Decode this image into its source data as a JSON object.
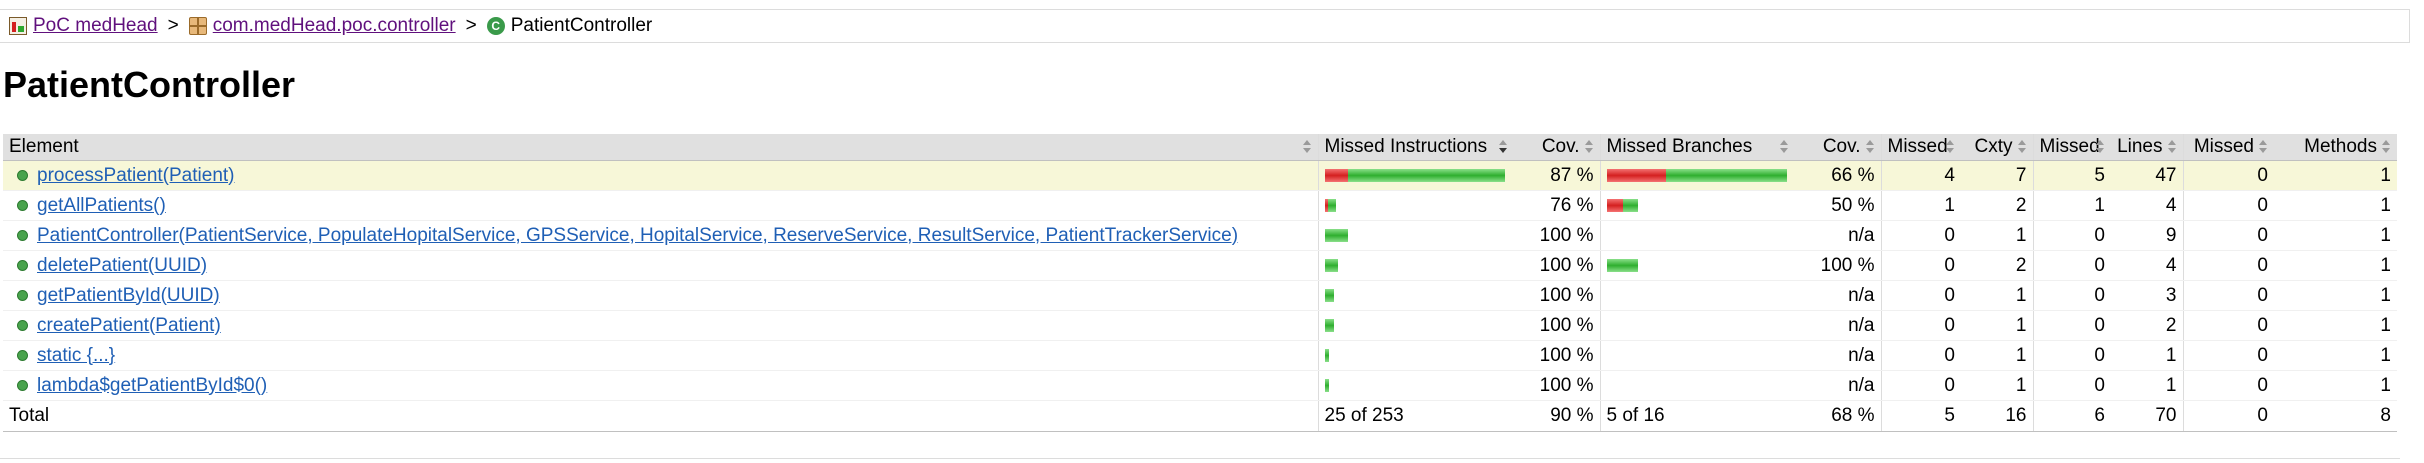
{
  "breadcrumb": {
    "report": "PoC medHead",
    "separator": ">",
    "package": "com.medHead.poc.controller",
    "current": "PatientController"
  },
  "page_title": "PatientController",
  "table": {
    "headers": {
      "element": "Element",
      "missed_instructions": "Missed Instructions",
      "cov1": "Cov.",
      "missed_branches": "Missed Branches",
      "cov2": "Cov.",
      "missed_cxty": "Missed",
      "cxty": "Cxty",
      "missed_lines": "Missed",
      "lines": "Lines",
      "missed_methods": "Missed",
      "methods": "Methods"
    },
    "rows": [
      {
        "name": "processPatient(Patient)",
        "instr_cov": "87 %",
        "branch_cov": "66 %",
        "missed_cxty": "4",
        "cxty": "7",
        "missed_lines": "5",
        "lines": "47",
        "missed_methods": "0",
        "methods": "1"
      },
      {
        "name": "getAllPatients()",
        "instr_cov": "76 %",
        "branch_cov": "50 %",
        "missed_cxty": "1",
        "cxty": "2",
        "missed_lines": "1",
        "lines": "4",
        "missed_methods": "0",
        "methods": "1"
      },
      {
        "name": "PatientController(PatientService, PopulateHopitalService, GPSService, HopitalService, ReserveService, ResultService, PatientTrackerService)",
        "instr_cov": "100 %",
        "branch_cov": "n/a",
        "missed_cxty": "0",
        "cxty": "1",
        "missed_lines": "0",
        "lines": "9",
        "missed_methods": "0",
        "methods": "1"
      },
      {
        "name": "deletePatient(UUID)",
        "instr_cov": "100 %",
        "branch_cov": "100 %",
        "missed_cxty": "0",
        "cxty": "2",
        "missed_lines": "0",
        "lines": "4",
        "missed_methods": "0",
        "methods": "1"
      },
      {
        "name": "getPatientById(UUID)",
        "instr_cov": "100 %",
        "branch_cov": "n/a",
        "missed_cxty": "0",
        "cxty": "1",
        "missed_lines": "0",
        "lines": "3",
        "missed_methods": "0",
        "methods": "1"
      },
      {
        "name": "createPatient(Patient)",
        "instr_cov": "100 %",
        "branch_cov": "n/a",
        "missed_cxty": "0",
        "cxty": "1",
        "missed_lines": "0",
        "lines": "2",
        "missed_methods": "0",
        "methods": "1"
      },
      {
        "name": "static {...}",
        "instr_cov": "100 %",
        "branch_cov": "n/a",
        "missed_cxty": "0",
        "cxty": "1",
        "missed_lines": "0",
        "lines": "1",
        "missed_methods": "0",
        "methods": "1"
      },
      {
        "name": "lambda$getPatientById$0()",
        "instr_cov": "100 %",
        "branch_cov": "n/a",
        "missed_cxty": "0",
        "cxty": "1",
        "missed_lines": "0",
        "lines": "1",
        "missed_methods": "0",
        "methods": "1"
      }
    ],
    "instr_bars": [
      {
        "missed_fraction": 0.13,
        "length_fraction": 1.0
      },
      {
        "missed_fraction": 0.24,
        "length_fraction": 0.06
      },
      {
        "missed_fraction": 0.0,
        "length_fraction": 0.13
      },
      {
        "missed_fraction": 0.0,
        "length_fraction": 0.07
      },
      {
        "missed_fraction": 0.0,
        "length_fraction": 0.05
      },
      {
        "missed_fraction": 0.0,
        "length_fraction": 0.05
      },
      {
        "missed_fraction": 0.0,
        "length_fraction": 0.02
      },
      {
        "missed_fraction": 0.0,
        "length_fraction": 0.02
      }
    ],
    "branch_bars": [
      {
        "missed_fraction": 0.33,
        "length_fraction": 1.0
      },
      {
        "missed_fraction": 0.5,
        "length_fraction": 0.17
      },
      null,
      {
        "missed_fraction": 0.0,
        "length_fraction": 0.17
      },
      null,
      null,
      null,
      null
    ],
    "total": {
      "label": "Total",
      "missed_instructions": "25 of 253",
      "instr_cov": "90 %",
      "missed_branches": "5 of 16",
      "branch_cov": "68 %",
      "missed_cxty": "5",
      "cxty": "16",
      "missed_lines": "6",
      "lines": "70",
      "missed_methods": "0",
      "methods": "8"
    }
  },
  "colors": {
    "missed": "#d42020",
    "covered": "#2fae2f",
    "link": "#1f5fb5",
    "visited": "#60107d",
    "highlight": "#f7f7d8"
  }
}
